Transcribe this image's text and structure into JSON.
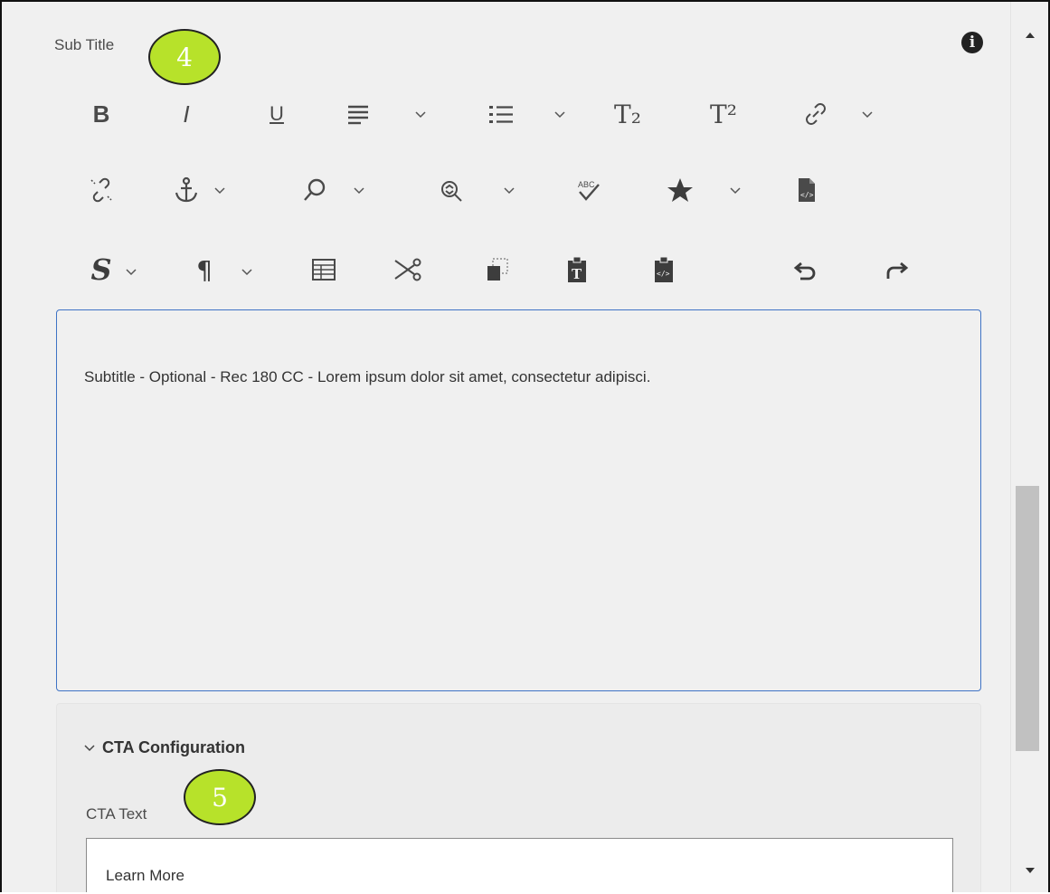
{
  "field": {
    "label": "Sub Title",
    "badge": "4",
    "info_icon": "info-icon"
  },
  "toolbar": {
    "row1": [
      "bold-icon",
      "italic-icon",
      "underline-icon",
      "align-icon",
      "list-icon",
      "subscript-icon",
      "superscript-icon",
      "link-icon"
    ],
    "row2": [
      "unlink-icon",
      "anchor-icon",
      "find-icon",
      "replace-icon",
      "spellcheck-icon",
      "special-char-icon",
      "source-edit-icon"
    ],
    "row3": [
      "styles-icon",
      "paragraph-icon",
      "table-icon",
      "cut-icon",
      "copy-icon",
      "paste-text-icon",
      "paste-html-icon",
      "undo-icon",
      "redo-icon"
    ],
    "glyphs": {
      "bold": "B",
      "italic": "I",
      "underline": "U",
      "subscript": "T₂",
      "superscript": "T²",
      "styles": "S",
      "paragraph": "¶"
    }
  },
  "editor": {
    "content": "Subtitle - Optional - Rec 180 CC - Lorem ipsum dolor sit amet, consectetur adipisci."
  },
  "cta": {
    "section_title": "CTA Configuration",
    "label": "CTA Text",
    "badge": "5",
    "value": "Learn More"
  },
  "colors": {
    "badge": "#b7e22a",
    "focus_border": "#3f73c5",
    "icon": "#4a4a4a"
  }
}
